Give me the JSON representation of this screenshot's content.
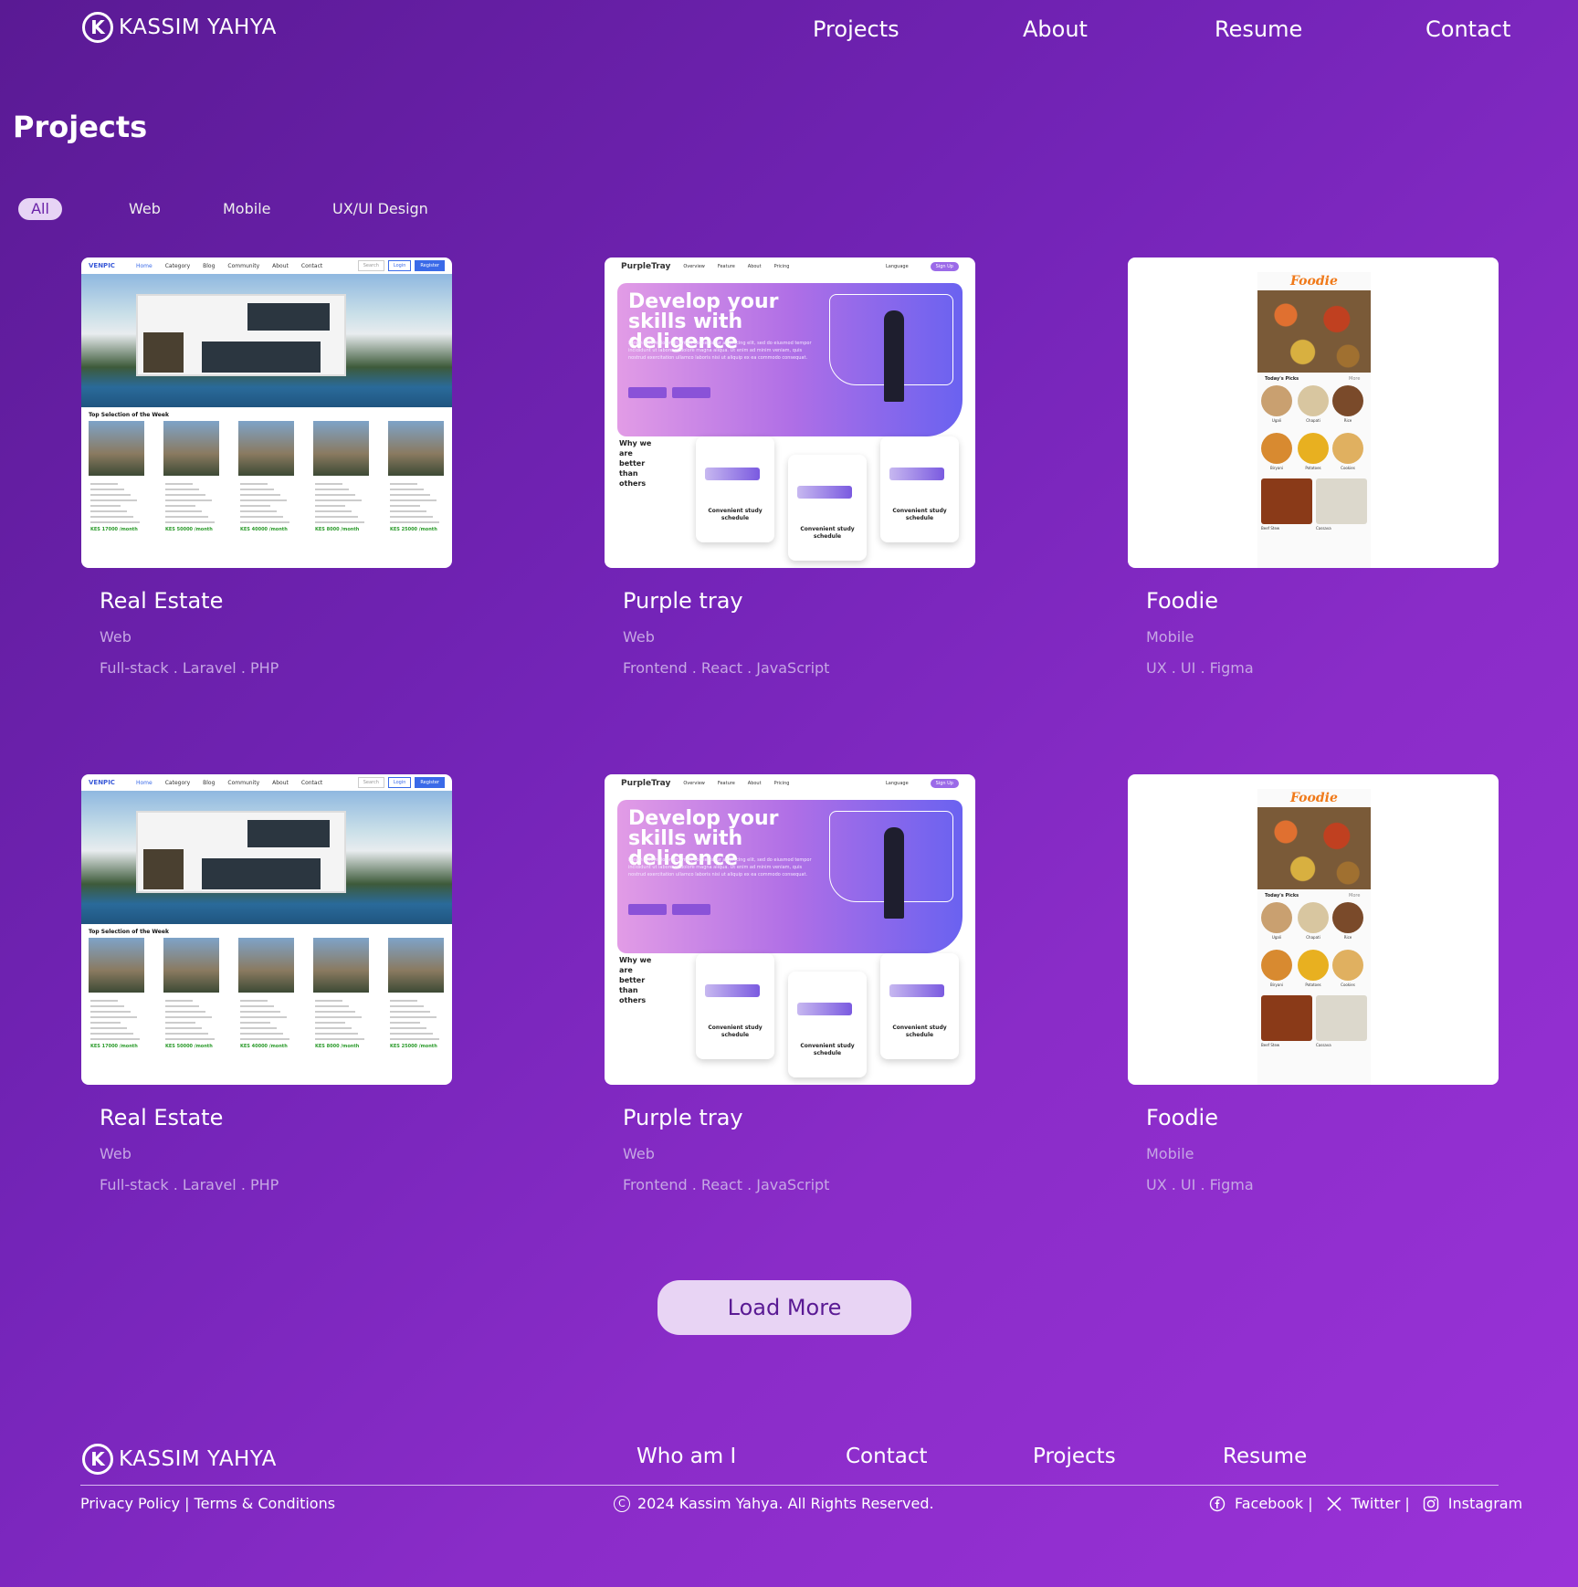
{
  "brand": {
    "name": "KASSIM YAHYA",
    "mark": "K"
  },
  "nav": [
    "Projects",
    "About",
    "Resume",
    "Contact"
  ],
  "page_title": "Projects",
  "filters": {
    "items": [
      "All",
      "Web",
      "Mobile",
      "UX/UI Design"
    ],
    "active": "All"
  },
  "thumbs": {
    "real_estate": {
      "nav": [
        "Home",
        "Category",
        "Blog",
        "Community",
        "About",
        "Contact"
      ],
      "search": "Search",
      "login": "Login",
      "register": "Register",
      "section": "Top Selection of the Week",
      "prices": [
        "KES 17000 /month",
        "KES 50000 /month",
        "KES 40000 /month",
        "KES 8000 /month",
        "KES 25000 /month"
      ]
    },
    "purple_tray": {
      "logo": "PurpleTray",
      "nav": [
        "Overview",
        "Feature",
        "About",
        "Pricing"
      ],
      "language": "Language",
      "signup": "Sign Up",
      "headline": "Develop your skills with deligence",
      "body": "Lorem ipsum dolor sit amet, consectetur adipiscing elit, sed do eiusmod tempor incididunt ut labore et dolore magna aliqua. Ut enim ad minim veniam, quis nostrud exercitation ullamco laboris nisi ut aliquip ex ea commodo consequat.",
      "btn1": "Get Started",
      "btn2": "Discover",
      "why": "Why we are better than others",
      "card": "Convenient study schedule"
    },
    "foodie": {
      "logo": "Foodie",
      "section": "Today's Picks",
      "more": "More",
      "dishes": [
        "Ugali",
        "Chapati",
        "Rice",
        "Biryani",
        "Potatoes",
        "Cookies"
      ],
      "big": [
        "Beef Stew",
        "Cassava"
      ]
    }
  },
  "projects": [
    {
      "title": "Real Estate",
      "category": "Web",
      "tags": "Full-stack . Laravel . PHP"
    },
    {
      "title": "Purple tray",
      "category": "Web",
      "tags": "Frontend . React . JavaScript"
    },
    {
      "title": "Foodie",
      "category": "Mobile",
      "tags": "UX . UI . Figma"
    },
    {
      "title": "Real Estate",
      "category": "Web",
      "tags": "Full-stack . Laravel . PHP"
    },
    {
      "title": "Purple tray",
      "category": "Web",
      "tags": "Frontend . React . JavaScript"
    },
    {
      "title": "Foodie",
      "category": "Mobile",
      "tags": "UX . UI . Figma"
    }
  ],
  "load_more": "Load More",
  "footer": {
    "nav": [
      "Who am I",
      "Contact",
      "Projects",
      "Resume"
    ],
    "legal": "Privacy Policy | Terms & Conditions",
    "copyright": "2024 Kassim Yahya. All Rights Reserved.",
    "socials": [
      "Facebook |",
      "Twitter |",
      "Instagram"
    ]
  },
  "colors": {
    "bg_start": "#5a1a94",
    "bg_end": "#9a32d8",
    "button_bg": "#e8d4f4",
    "muted_text": "#c6a7e4"
  }
}
